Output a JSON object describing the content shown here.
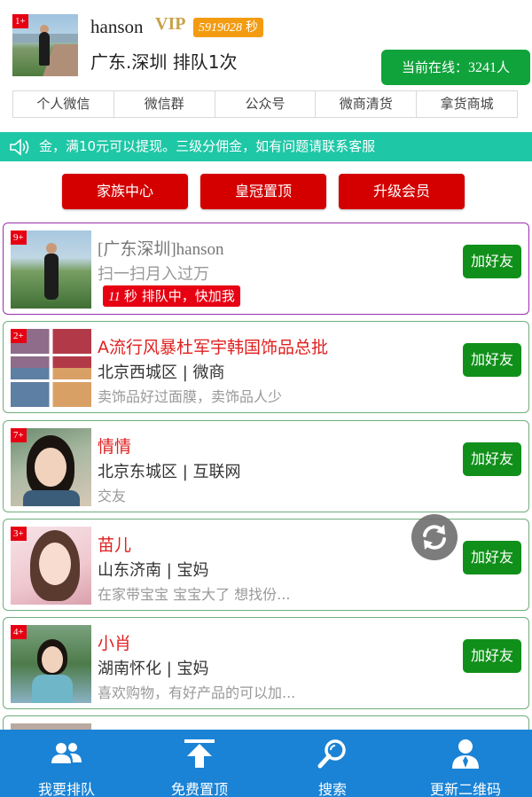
{
  "profile": {
    "rank_badge": "1+",
    "name": "hanson",
    "vip": "VIP",
    "seconds_value": "5919028",
    "seconds_unit": "秒",
    "location_status": "广东.深圳  排队1次",
    "online_label": "当前在线：",
    "online_count": "3241",
    "online_unit": "人"
  },
  "nav_tabs": [
    "个人微信",
    "微信群",
    "公众号",
    "微商清货",
    "拿货商城"
  ],
  "notice": "金，满10元可以提现。三级分佣金，如有问题请联系客服",
  "actions": [
    "家族中心",
    "皇冠置顶",
    "升级会员"
  ],
  "list": [
    {
      "rank": "9+",
      "title": "[广东深圳]hanson",
      "subtitle": "扫一扫月入过万",
      "queue_seconds": "11",
      "queue_unit": "秒",
      "queue_text": "排队中，快加我",
      "button": "加好友"
    },
    {
      "rank": "2+",
      "title": "A流行风暴杜军宇韩国饰品总批",
      "subtitle": "北京西城区 | 微商",
      "desc": "卖饰品好过面膜，卖饰品人少",
      "button": "加好友"
    },
    {
      "rank": "7+",
      "title": "情情",
      "subtitle": "北京东城区 | 互联网",
      "desc": "交友",
      "button": "加好友"
    },
    {
      "rank": "3+",
      "title": "苗儿",
      "subtitle": "山东济南 | 宝妈",
      "desc": "在家带宝宝 宝宝大了 想找份...",
      "button": "加好友"
    },
    {
      "rank": "4+",
      "title": "小肖",
      "subtitle": "湖南怀化 | 宝妈",
      "desc": "喜欢购物，有好产品的可以加...",
      "button": "加好友"
    }
  ],
  "bottom_bar": [
    {
      "label": "我要排队",
      "icon": "users-icon"
    },
    {
      "label": "免费置顶",
      "icon": "upload-top-icon"
    },
    {
      "label": "搜索",
      "icon": "search-icon"
    },
    {
      "label": "更新二维码",
      "icon": "user-icon"
    }
  ],
  "colors": {
    "accent_green": "#10a33c",
    "accent_red": "#d40000",
    "notice_teal": "#1ec7a6",
    "bottom_blue": "#1a83d6"
  }
}
